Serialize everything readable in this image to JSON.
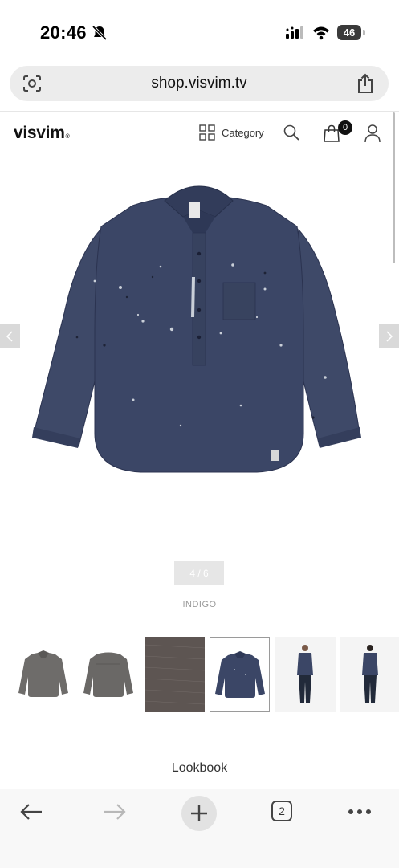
{
  "status_bar": {
    "time": "20:46",
    "battery": "46"
  },
  "browser": {
    "url": "shop.visvim.tv",
    "tab_count": "2"
  },
  "header": {
    "logo": "visvim",
    "logo_mark": "®",
    "category_label": "Category",
    "cart_count": "0"
  },
  "product": {
    "image_counter": "4 / 6",
    "color": "INDIGO",
    "thumbnails": [
      "grey-shirt-front",
      "grey-shirt-back",
      "fabric-swatch",
      "indigo-shirt-front",
      "model-front",
      "model-back"
    ],
    "selected_thumbnail": 3
  },
  "lookbook_label": "Lookbook",
  "colors": {
    "indigo": "#3b4666",
    "grey": "#6e6c6a",
    "badge": "#111111",
    "counter_bg": "#e6e6e6"
  }
}
